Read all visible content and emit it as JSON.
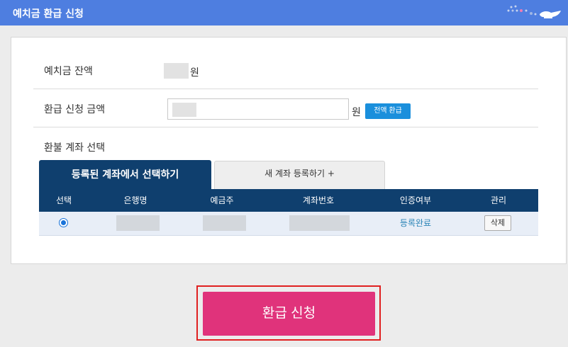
{
  "header": {
    "title": "예치금 환급 신청",
    "icon": "genie-lamp-icon"
  },
  "balance": {
    "label": "예치금 잔액",
    "unit": "원"
  },
  "refund_amount": {
    "label": "환급 신청 금액",
    "unit": "원",
    "all_button": "전액 환급"
  },
  "account": {
    "label": "환불 계좌 선택",
    "tabs": [
      "등록된 계좌에서 선택하기",
      "새 계좌 등록하기 +"
    ],
    "columns": [
      "선택",
      "은행명",
      "예금주",
      "계좌번호",
      "인증여부",
      "관리"
    ],
    "rows": [
      {
        "selected": true,
        "status": "등록완료",
        "action": "삭제"
      }
    ]
  },
  "submit": {
    "label": "환급 신청"
  },
  "colors": {
    "header_bg": "#4e7ee0",
    "table_header": "#0f3f6e",
    "accent_pink": "#e0337b",
    "focus_red": "#e02020",
    "link_blue": "#2e86b8"
  }
}
